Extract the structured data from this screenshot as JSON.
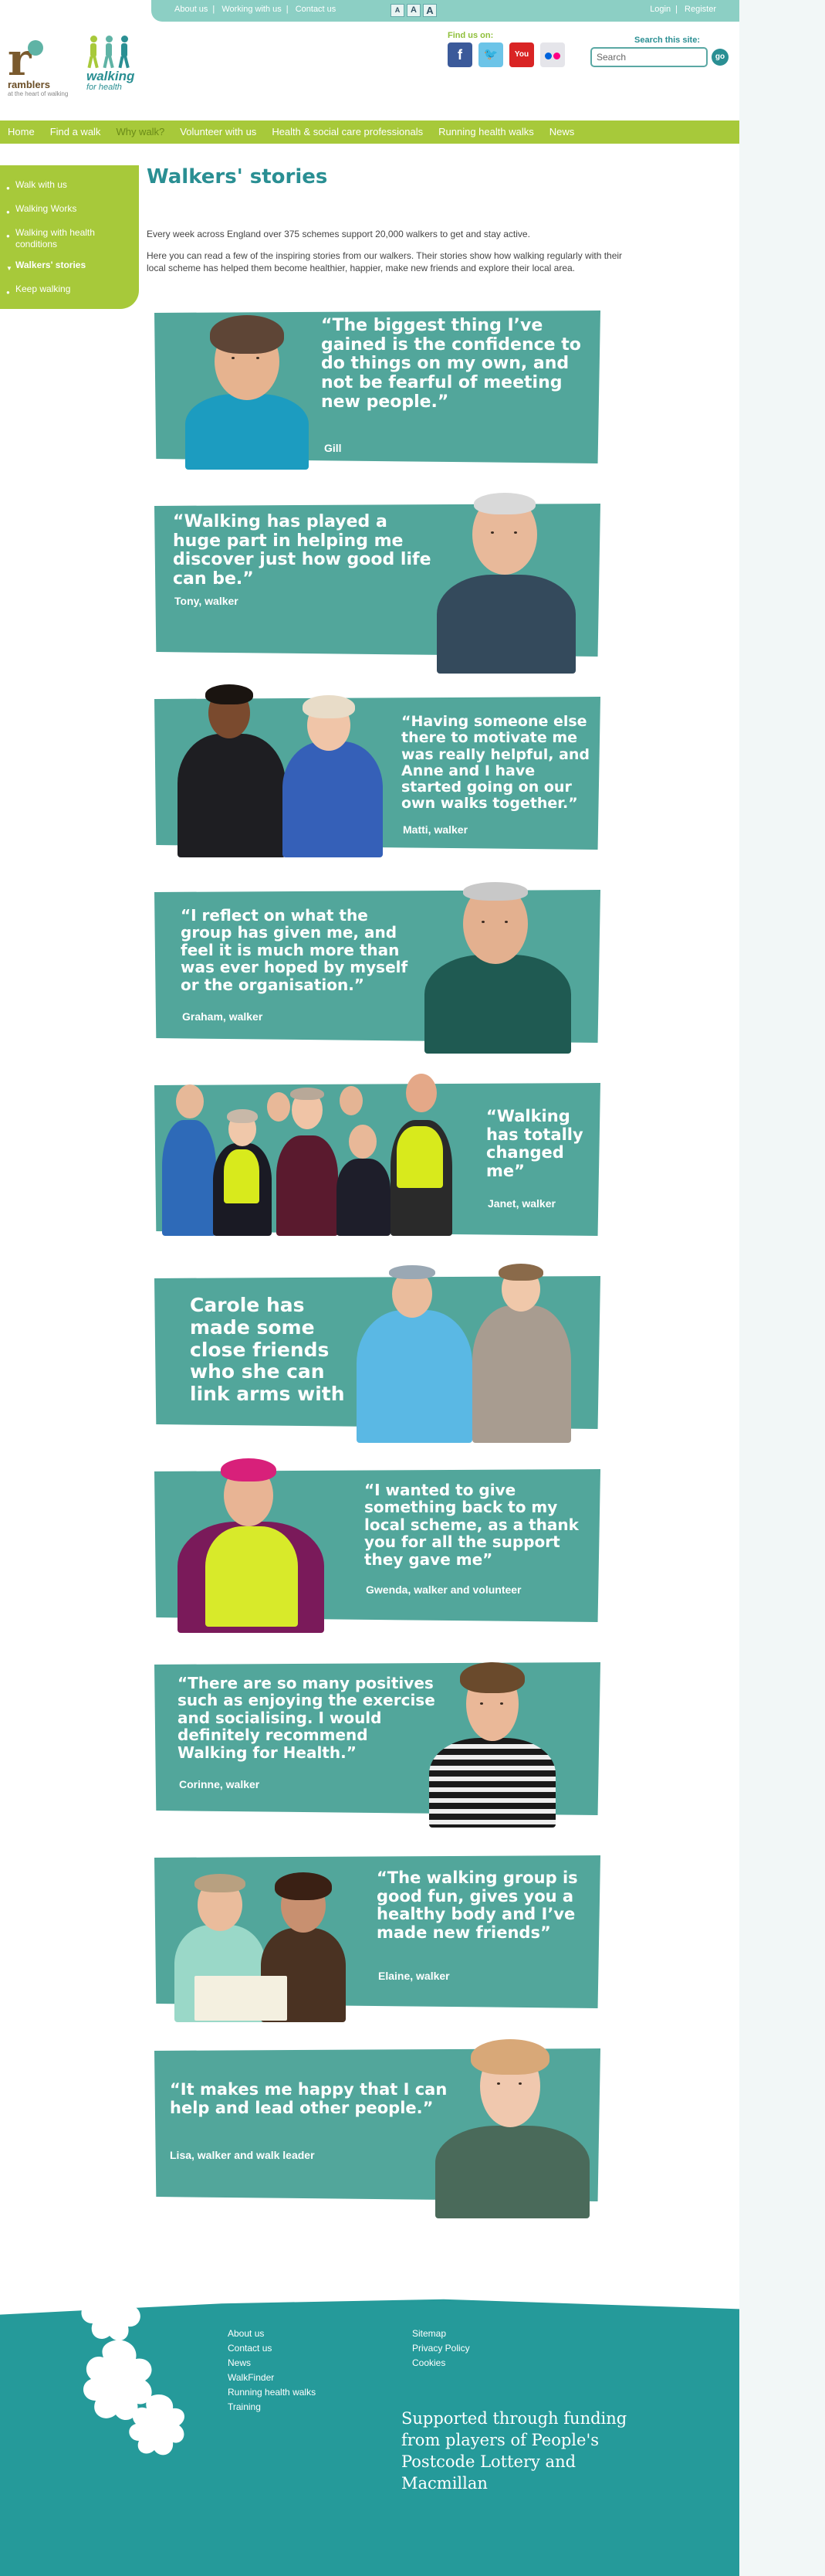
{
  "topbar": {
    "links": [
      "About us",
      "Working with us",
      "Contact us"
    ],
    "font_sizes": [
      "A",
      "A",
      "A"
    ],
    "account": [
      "Login",
      "Register"
    ]
  },
  "logos": {
    "ramblers": {
      "glyph": "r",
      "name": "ramblers",
      "tag": "at the heart of walking"
    },
    "walking": {
      "line1": "walking",
      "line2": "for health"
    }
  },
  "findus": {
    "label": "Find us on:",
    "icons": [
      "facebook-icon",
      "twitter-icon",
      "youtube-icon",
      "flickr-icon"
    ],
    "youtube_text": "You Tube"
  },
  "search": {
    "label": "Search this site:",
    "placeholder": "Search",
    "value": "Search",
    "go": "go"
  },
  "nav": [
    "Home",
    "Find a walk",
    "Why walk?",
    "Volunteer with us",
    "Health & social care professionals",
    "Running health walks",
    "News"
  ],
  "nav_active": "Why walk?",
  "sidebar": [
    "Walk with us",
    "Walking Works",
    "Walking with health conditions",
    "Walkers' stories",
    "Keep walking"
  ],
  "sidebar_active": "Walkers' stories",
  "main": {
    "title": "Walkers' stories",
    "intro1": "Every week across England over 375 schemes support 20,000 walkers to get and stay active.",
    "intro2": "Here you can read a few of the inspiring stories from our walkers. Their stories show how walking regularly with their local scheme has helped them become healthier, happier, make new friends and explore their local area."
  },
  "stories": [
    {
      "quote": "“The biggest thing I’ve gained is the confidence to do things on my own, and not be fearful of meeting new people.”",
      "attr": "Gill"
    },
    {
      "quote": "“Walking has played a huge part in helping me discover just how good life can be.”",
      "attr": "Tony, walker"
    },
    {
      "quote": "“Having someone else there to motivate me was really helpful, and Anne and I have started going on our own walks together.”",
      "attr": "Matti, walker"
    },
    {
      "quote": "“I reflect on what the group has given me, and feel it is much more than was ever hoped by myself or the organisation.”",
      "attr": "Graham, walker"
    },
    {
      "quote": "“Walking has totally changed me”",
      "attr": "Janet, walker"
    },
    {
      "quote": "Carole has made some close friends who she can link arms with",
      "attr": ""
    },
    {
      "quote": "“I wanted to give something back to my local scheme, as a thank you for all the support they gave me”",
      "attr": "Gwenda, walker and volunteer"
    },
    {
      "quote": "“There are so many positives such as enjoying the exercise and socialising. I would definitely recommend Walking for Health.”",
      "attr": "Corinne, walker"
    },
    {
      "quote": "“The walking group is good fun, gives you a healthy body and I’ve made new friends”",
      "attr": "Elaine, walker"
    },
    {
      "quote": "“It makes me happy that I can help and lead other people.”",
      "attr": "Lisa, walker and walk leader"
    }
  ],
  "footer": {
    "links1": [
      "About us",
      "Contact us",
      "News",
      "WalkFinder",
      "Running health walks",
      "Training"
    ],
    "links2": [
      "Sitemap",
      "Privacy Policy",
      "Cookies"
    ],
    "funded": "Supported through funding from players of People's Postcode Lottery and Macmillan"
  },
  "colors": {
    "teal": "#52a69b",
    "green": "#a7c93a",
    "dark_teal": "#259a9a",
    "title_teal": "#2a8f93"
  }
}
